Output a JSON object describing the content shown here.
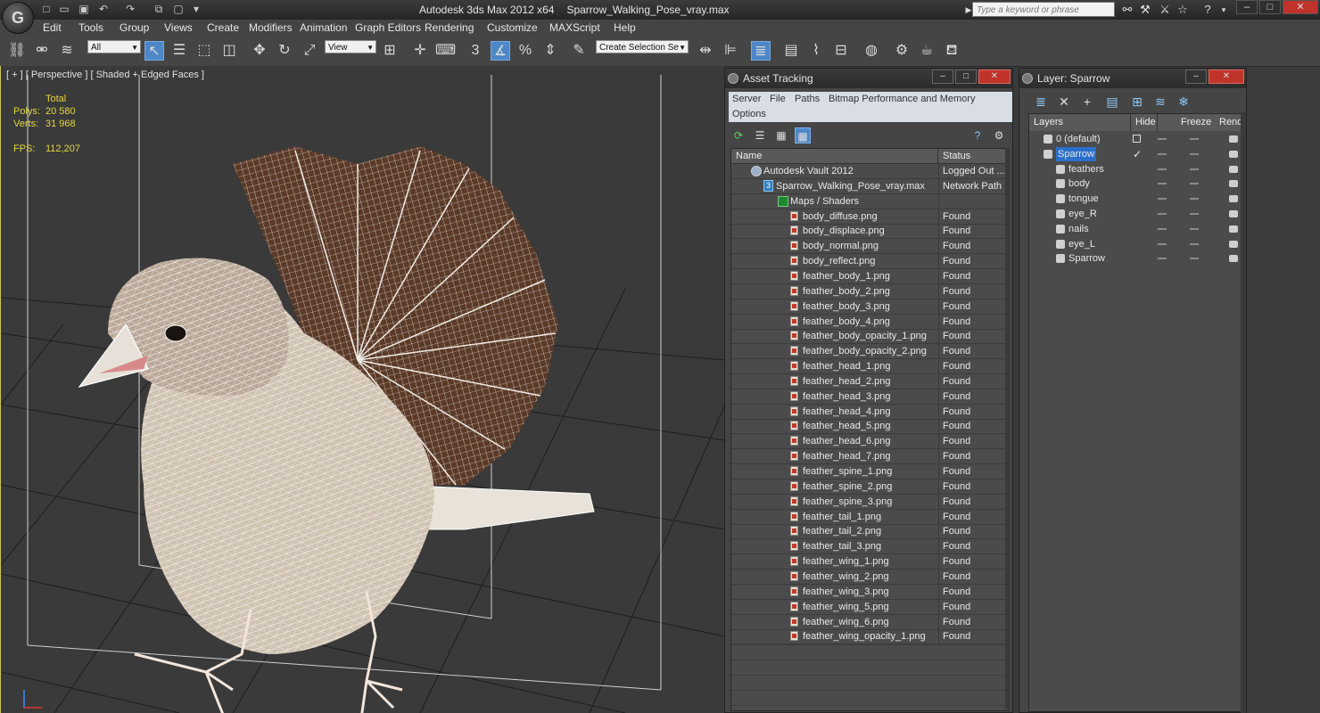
{
  "window": {
    "app_title": "Autodesk 3ds Max  2012 x64",
    "file_name": "Sparrow_Walking_Pose_vray.max",
    "search_placeholder": "Type a keyword or phrase",
    "logo": "G"
  },
  "menu": [
    "Edit",
    "Tools",
    "Group",
    "Views",
    "Create",
    "Modifiers",
    "Animation",
    "Graph Editors",
    "Rendering",
    "Customize",
    "MAXScript",
    "Help"
  ],
  "toolbar": {
    "selection_filter": "All",
    "reference_coord": "View",
    "named_selection": "Create Selection Se"
  },
  "viewport": {
    "label": "[ + ] [ Perspective ] [ Shaded + Edged Faces ]",
    "stats": {
      "total_label": "Total",
      "polys_label": "Polys:",
      "polys_value": "20 580",
      "verts_label": "Verts:",
      "verts_value": "31 968",
      "fps_label": "FPS:",
      "fps_value": "112,207"
    }
  },
  "asset_tracking": {
    "title": "Asset Tracking",
    "menu_row1": [
      "Server",
      "File",
      "Paths",
      "Bitmap Performance and Memory"
    ],
    "menu_row2": [
      "Options"
    ],
    "columns": [
      "Name",
      "Status"
    ],
    "vault": {
      "name": "Autodesk Vault 2012",
      "status": "Logged Out ..."
    },
    "scene_file": {
      "name": "Sparrow_Walking_Pose_vray.max",
      "status": "Network Path"
    },
    "maps_folder": {
      "name": "Maps / Shaders",
      "status": ""
    },
    "files": [
      {
        "name": "body_diffuse.png",
        "status": "Found"
      },
      {
        "name": "body_displace.png",
        "status": "Found"
      },
      {
        "name": "body_normal.png",
        "status": "Found"
      },
      {
        "name": "body_reflect.png",
        "status": "Found"
      },
      {
        "name": "feather_body_1.png",
        "status": "Found"
      },
      {
        "name": "feather_body_2.png",
        "status": "Found"
      },
      {
        "name": "feather_body_3.png",
        "status": "Found"
      },
      {
        "name": "feather_body_4.png",
        "status": "Found"
      },
      {
        "name": "feather_body_opacity_1.png",
        "status": "Found"
      },
      {
        "name": "feather_body_opacity_2.png",
        "status": "Found"
      },
      {
        "name": "feather_head_1.png",
        "status": "Found"
      },
      {
        "name": "feather_head_2.png",
        "status": "Found"
      },
      {
        "name": "feather_head_3.png",
        "status": "Found"
      },
      {
        "name": "feather_head_4.png",
        "status": "Found"
      },
      {
        "name": "feather_head_5.png",
        "status": "Found"
      },
      {
        "name": "feather_head_6.png",
        "status": "Found"
      },
      {
        "name": "feather_head_7.png",
        "status": "Found"
      },
      {
        "name": "feather_spine_1.png",
        "status": "Found"
      },
      {
        "name": "feather_spine_2.png",
        "status": "Found"
      },
      {
        "name": "feather_spine_3.png",
        "status": "Found"
      },
      {
        "name": "feather_tail_1.png",
        "status": "Found"
      },
      {
        "name": "feather_tail_2.png",
        "status": "Found"
      },
      {
        "name": "feather_tail_3.png",
        "status": "Found"
      },
      {
        "name": "feather_wing_1.png",
        "status": "Found"
      },
      {
        "name": "feather_wing_2.png",
        "status": "Found"
      },
      {
        "name": "feather_wing_3.png",
        "status": "Found"
      },
      {
        "name": "feather_wing_5.png",
        "status": "Found"
      },
      {
        "name": "feather_wing_6.png",
        "status": "Found"
      },
      {
        "name": "feather_wing_opacity_1.png",
        "status": "Found"
      }
    ]
  },
  "layer_panel": {
    "title": "Layer: Sparrow",
    "columns": [
      "Layers",
      "Hide",
      "Freeze",
      "Rende"
    ],
    "layers": [
      {
        "name": "0 (default)",
        "level": 0,
        "selected": false
      },
      {
        "name": "Sparrow",
        "level": 0,
        "selected": true
      },
      {
        "name": "feathers",
        "level": 1,
        "selected": false
      },
      {
        "name": "body",
        "level": 1,
        "selected": false
      },
      {
        "name": "tongue",
        "level": 1,
        "selected": false
      },
      {
        "name": "eye_R",
        "level": 1,
        "selected": false
      },
      {
        "name": "nails",
        "level": 1,
        "selected": false
      },
      {
        "name": "eye_L",
        "level": 1,
        "selected": false
      },
      {
        "name": "Sparrow",
        "level": 1,
        "selected": false
      }
    ]
  }
}
